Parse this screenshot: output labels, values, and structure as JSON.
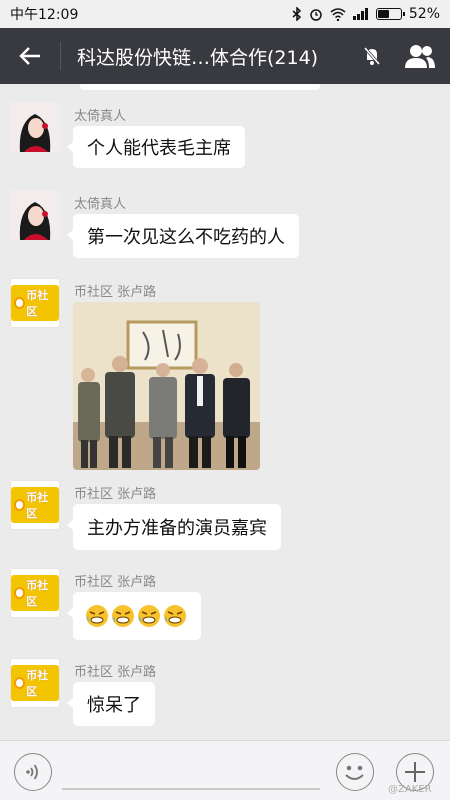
{
  "status": {
    "time": "中午12:09",
    "battery": "52%",
    "battery_level": 0.52
  },
  "header": {
    "title": "科达股份快链…体合作(214)",
    "back_icon": "back-arrow-icon",
    "mute_icon": "bell-muted-icon",
    "members_icon": "group-members-icon"
  },
  "messages": [
    {
      "sender": "太倚真人",
      "text": "个人能代表毛主席",
      "avatar": "portrait-woman"
    },
    {
      "sender": "太倚真人",
      "text": "第一次见这么不吃药的人",
      "avatar": "portrait-woman"
    },
    {
      "sender": "币社区 张卢路",
      "type": "image",
      "avatar": "bishequ-logo"
    },
    {
      "sender": "币社区 张卢路",
      "text": "主办方准备的演员嘉宾",
      "avatar": "bishequ-logo"
    },
    {
      "sender": "币社区 张卢路",
      "type": "emoji",
      "emoji": [
        "grimace-emoji",
        "grimace-emoji",
        "grimace-emoji",
        "grimace-emoji"
      ],
      "avatar": "bishequ-logo"
    },
    {
      "sender": "币社区 张卢路",
      "text": "惊呆了",
      "avatar": "bishequ-logo"
    }
  ],
  "logo_text": "币社区",
  "input": {
    "voice_icon": "voice-icon",
    "emoji_icon": "smiley-icon",
    "plus_icon": "plus-icon"
  },
  "watermark": "@ZAKER",
  "colors": {
    "header_bg": "#393a3f",
    "chat_bg": "#ebebeb",
    "bubble": "#ffffff"
  }
}
